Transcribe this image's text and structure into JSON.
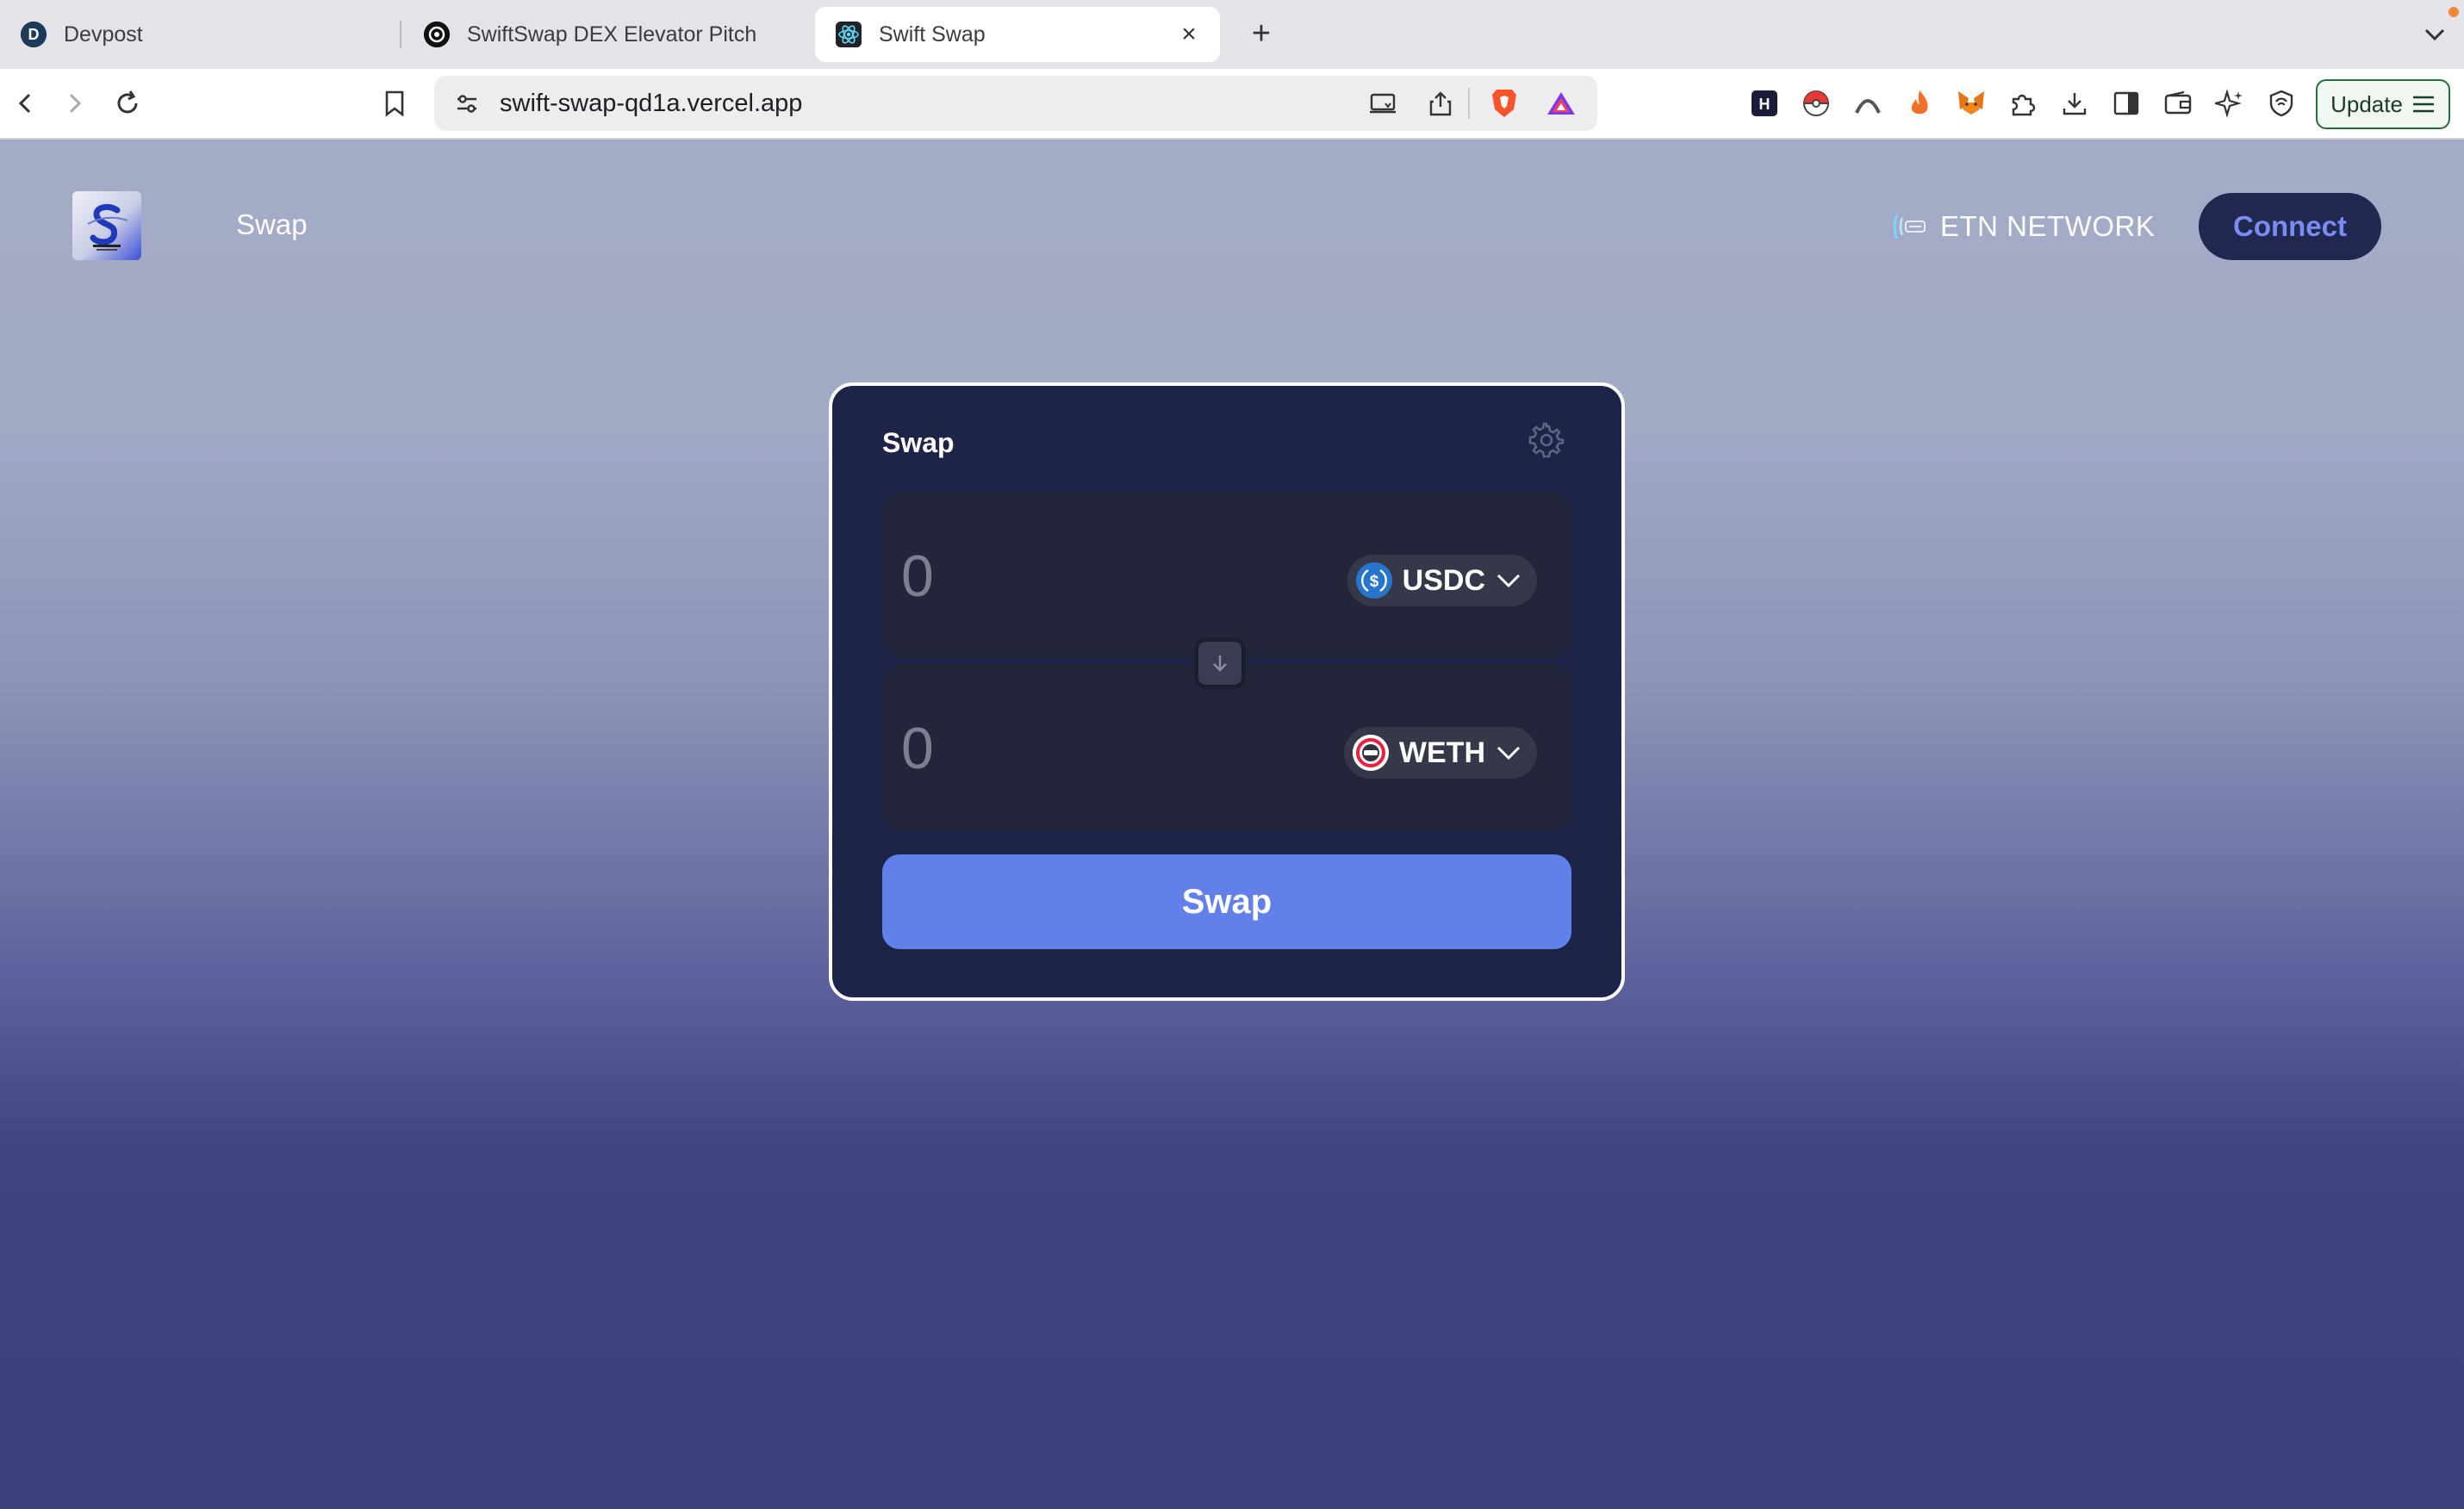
{
  "browser": {
    "tabs": [
      {
        "title": "Devpost",
        "active": false,
        "favicon": "devpost-icon"
      },
      {
        "title": "SwiftSwap DEX Elevator Pitch",
        "active": false,
        "favicon": "openai-icon"
      },
      {
        "title": "Swift Swap",
        "active": true,
        "favicon": "react-icon"
      }
    ],
    "url": "swift-swap-qd1a.vercel.app",
    "update_label": "Update"
  },
  "app": {
    "nav": {
      "swap_label": "Swap"
    },
    "network_label": "ETN NETWORK",
    "connect_label": "Connect"
  },
  "swap_card": {
    "title": "Swap",
    "from": {
      "amount_placeholder": "0",
      "token": "USDC"
    },
    "to": {
      "amount_placeholder": "0",
      "token": "WETH"
    },
    "submit_label": "Swap"
  },
  "colors": {
    "card_bg": "#1e2448",
    "accent": "#6280ea",
    "connect_bg": "#21284f",
    "connect_text": "#7a8cf0",
    "usdc_blue": "#2775ca"
  }
}
